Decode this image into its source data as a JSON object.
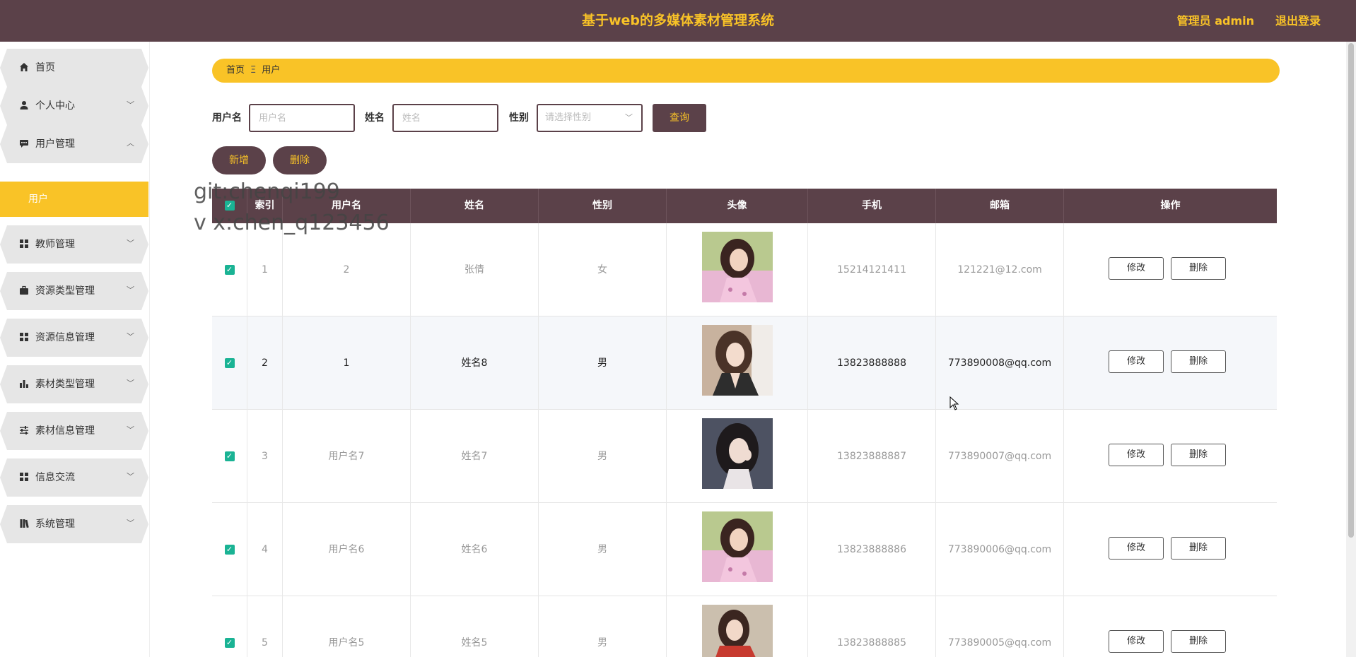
{
  "header": {
    "title": "基于web的多媒体素材管理系统",
    "user": "管理员 admin",
    "logout": "退出登录"
  },
  "sidebar": {
    "items": [
      {
        "label": "首页",
        "icon": "home-icon"
      },
      {
        "label": "个人中心",
        "icon": "user-icon"
      },
      {
        "label": "用户管理",
        "icon": "message-icon"
      },
      {
        "label": "教师管理",
        "icon": "grid-icon"
      },
      {
        "label": "资源类型管理",
        "icon": "briefcase-icon"
      },
      {
        "label": "资源信息管理",
        "icon": "grid-icon"
      },
      {
        "label": "素材类型管理",
        "icon": "bar-chart-icon"
      },
      {
        "label": "素材信息管理",
        "icon": "sliders-icon"
      },
      {
        "label": "信息交流",
        "icon": "grid-icon"
      },
      {
        "label": "系统管理",
        "icon": "book-icon"
      }
    ],
    "active_sub": "用户"
  },
  "breadcrumb": {
    "home": "首页",
    "current": "用户"
  },
  "search": {
    "username_label": "用户名",
    "username_placeholder": "用户名",
    "name_label": "姓名",
    "name_placeholder": "姓名",
    "gender_label": "性别",
    "gender_placeholder": "请选择性别",
    "query": "查询"
  },
  "actions": {
    "add": "新增",
    "delete": "删除"
  },
  "table": {
    "headers": [
      "索引",
      "用户名",
      "姓名",
      "性别",
      "头像",
      "手机",
      "邮箱",
      "操作"
    ],
    "rows": [
      {
        "index": "1",
        "username": "2",
        "name": "张倩",
        "gender": "女",
        "phone": "15214121411",
        "email": "121221@12.com"
      },
      {
        "index": "2",
        "username": "1",
        "name": "姓名8",
        "gender": "男",
        "phone": "13823888888",
        "email": "773890008@qq.com"
      },
      {
        "index": "3",
        "username": "用户名7",
        "name": "姓名7",
        "gender": "男",
        "phone": "13823888887",
        "email": "773890007@qq.com"
      },
      {
        "index": "4",
        "username": "用户名6",
        "name": "姓名6",
        "gender": "男",
        "phone": "13823888886",
        "email": "773890006@qq.com"
      },
      {
        "index": "5",
        "username": "用户名5",
        "name": "姓名5",
        "gender": "男",
        "phone": "13823888885",
        "email": "773890005@qq.com"
      }
    ],
    "edit": "修改",
    "delete": "删除"
  },
  "watermark": {
    "line1": "git:chenqi199",
    "line2": "v x:chen_q123456"
  },
  "colors": {
    "primary": "#5b4149",
    "accent": "#f9c327",
    "checkbox": "#1ab394"
  }
}
